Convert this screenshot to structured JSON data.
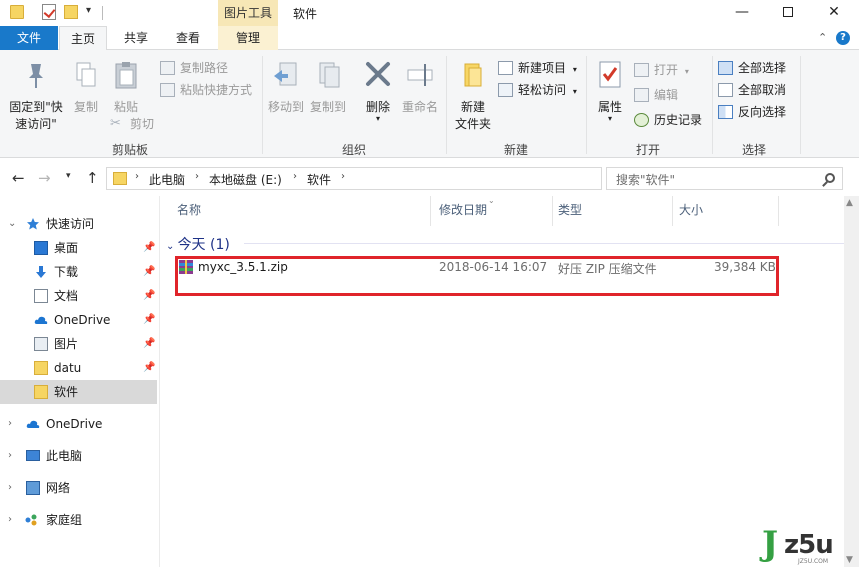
{
  "titlebar": {
    "context_tab_header": "图片工具",
    "window_title": "软件",
    "minimize": "—",
    "close": "✕"
  },
  "ribbon_tabs": {
    "file": "文件",
    "home": "主页",
    "share": "共享",
    "view": "查看",
    "manage": "管理"
  },
  "ribbon": {
    "clipboard": {
      "pin_line1": "固定到\"快",
      "pin_line2": "速访问\"",
      "copy": "复制",
      "paste": "粘贴",
      "copy_path": "复制路径",
      "paste_shortcut": "粘贴快捷方式",
      "cut": "剪切",
      "label": "剪贴板"
    },
    "organize": {
      "move_to": "移动到",
      "copy_to": "复制到",
      "delete": "删除",
      "rename": "重命名",
      "label": "组织"
    },
    "new": {
      "new_folder_line1": "新建",
      "new_folder_line2": "文件夹",
      "new_item": "新建项目",
      "easy_access": "轻松访问",
      "label": "新建"
    },
    "open": {
      "properties": "属性",
      "open": "打开",
      "edit": "编辑",
      "history": "历史记录",
      "label": "打开"
    },
    "select": {
      "select_all": "全部选择",
      "select_none": "全部取消",
      "invert": "反向选择",
      "label": "选择"
    }
  },
  "address": {
    "crumbs": [
      "此电脑",
      "本地磁盘 (E:)",
      "软件"
    ],
    "search_placeholder": "搜索\"软件\""
  },
  "nav": {
    "quick_access": "快速访问",
    "items": [
      {
        "label": "桌面"
      },
      {
        "label": "下载"
      },
      {
        "label": "文档"
      },
      {
        "label": "OneDrive"
      },
      {
        "label": "图片"
      },
      {
        "label": "datu"
      },
      {
        "label": "软件"
      }
    ],
    "onedrive": "OneDrive",
    "this_pc": "此电脑",
    "network": "网络",
    "homegroup": "家庭组"
  },
  "content": {
    "columns": [
      "名称",
      "修改日期",
      "类型",
      "大小"
    ],
    "group_label": "今天 (1)",
    "files": [
      {
        "name": "myxc_3.5.1.zip",
        "modified": "2018-06-14 16:07",
        "type": "好压 ZIP 压缩文件",
        "size": "39,384 KB"
      }
    ]
  },
  "watermark": {
    "brand": "z5u",
    "small": "JZ5U.COM"
  }
}
